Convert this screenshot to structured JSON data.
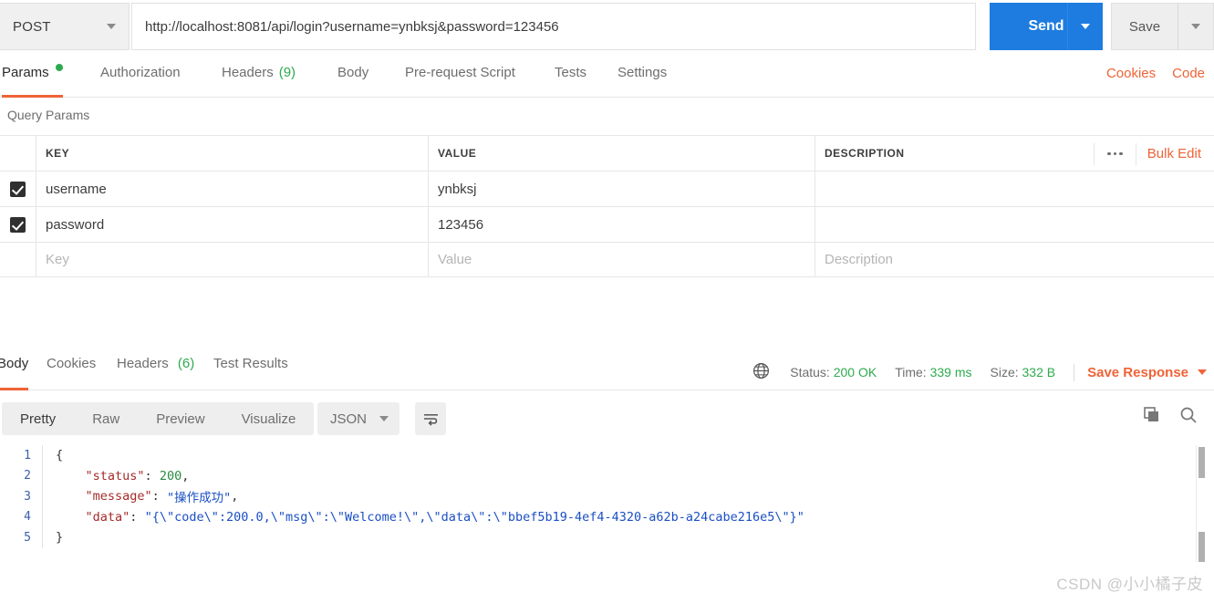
{
  "request": {
    "method": "POST",
    "url": "http://localhost:8081/api/login?username=ynbksj&password=123456",
    "send_label": "Send",
    "save_label": "Save"
  },
  "request_tabs": [
    {
      "label": "Params",
      "badge_dot": true,
      "active": true
    },
    {
      "label": "Authorization",
      "active": false
    },
    {
      "label": "Headers",
      "count": "(9)",
      "active": false
    },
    {
      "label": "Body",
      "active": false
    },
    {
      "label": "Pre-request Script",
      "active": false
    },
    {
      "label": "Tests",
      "active": false
    },
    {
      "label": "Settings",
      "active": false
    }
  ],
  "request_tab_links": {
    "cookies": "Cookies",
    "code": "Code"
  },
  "query_params": {
    "title": "Query Params",
    "columns": {
      "key": "KEY",
      "value": "VALUE",
      "description": "DESCRIPTION"
    },
    "bulk_edit": "Bulk Edit",
    "rows": [
      {
        "checked": true,
        "key": "username",
        "value": "ynbksj",
        "description": ""
      },
      {
        "checked": true,
        "key": "password",
        "value": "123456",
        "description": ""
      }
    ],
    "placeholder_row": {
      "key": "Key",
      "value": "Value",
      "description": "Description"
    }
  },
  "response_tabs": [
    {
      "label": "Body",
      "active": true
    },
    {
      "label": "Cookies",
      "active": false
    },
    {
      "label": "Headers",
      "count": "(6)",
      "active": false
    },
    {
      "label": "Test Results",
      "active": false
    }
  ],
  "response_status": {
    "status_label": "Status:",
    "status_value": "200 OK",
    "time_label": "Time:",
    "time_value": "339 ms",
    "size_label": "Size:",
    "size_value": "332 B",
    "save_response": "Save Response"
  },
  "view_toolbar": {
    "modes": [
      "Pretty",
      "Raw",
      "Preview",
      "Visualize"
    ],
    "active_mode": "Pretty",
    "format": "JSON"
  },
  "response_body": {
    "lines": [
      {
        "no": "1",
        "indent": 0,
        "tokens": [
          {
            "t": "pn",
            "v": "{"
          }
        ]
      },
      {
        "no": "2",
        "indent": 1,
        "tokens": [
          {
            "t": "k",
            "v": "\"status\""
          },
          {
            "t": "pn",
            "v": ": "
          },
          {
            "t": "num",
            "v": "200"
          },
          {
            "t": "pn",
            "v": ","
          }
        ]
      },
      {
        "no": "3",
        "indent": 1,
        "tokens": [
          {
            "t": "k",
            "v": "\"message\""
          },
          {
            "t": "pn",
            "v": ": "
          },
          {
            "t": "str",
            "v": "\"操作成功\""
          },
          {
            "t": "pn",
            "v": ","
          }
        ]
      },
      {
        "no": "4",
        "indent": 1,
        "tokens": [
          {
            "t": "k",
            "v": "\"data\""
          },
          {
            "t": "pn",
            "v": ": "
          },
          {
            "t": "str",
            "v": "\"{\\\"code\\\":200.0,\\\"msg\\\":\\\"Welcome!\\\",\\\"data\\\":\\\"bbef5b19-4ef4-4320-a62b-a24cabe216e5\\\"}\""
          }
        ]
      },
      {
        "no": "5",
        "indent": 0,
        "tokens": [
          {
            "t": "pn",
            "v": "}"
          }
        ]
      }
    ]
  },
  "watermark": "CSDN @小小橘子皮",
  "colors": {
    "accent_orange": "#ef6337",
    "send_blue": "#1e7ce0",
    "status_green": "#2eaa4e",
    "json_key": "#a52b2b",
    "json_string": "#1a4fc4",
    "json_number": "#2a8a43"
  }
}
